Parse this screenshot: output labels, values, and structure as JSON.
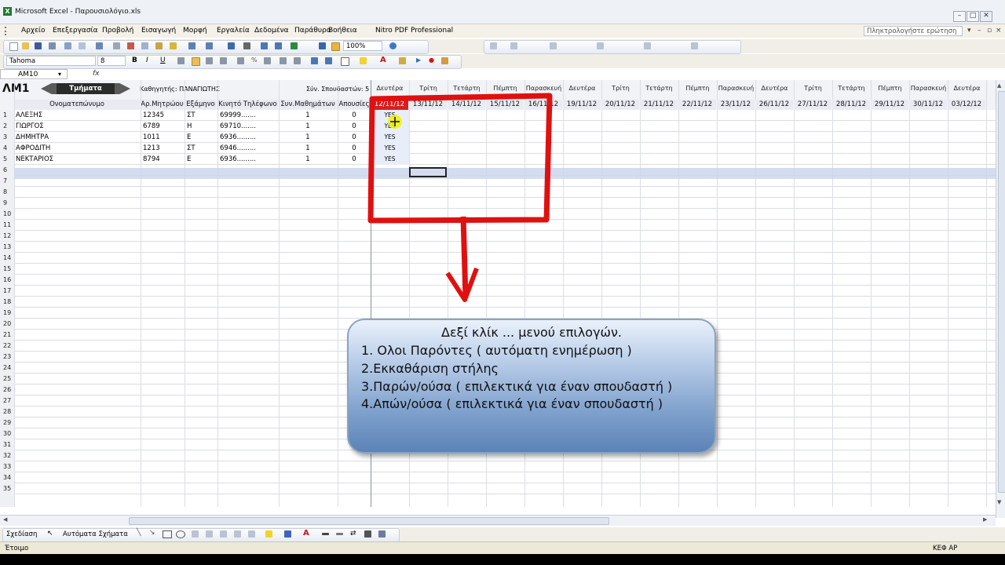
{
  "window": {
    "title": "Microsoft Excel - Παρουσιολόγιο.xls"
  },
  "menu": [
    "Αρχείο",
    "Επεξεργασία",
    "Προβολή",
    "Εισαγωγή",
    "Μορφή",
    "Εργαλεία",
    "Δεδομένα",
    "Παράθυρο",
    "Βοήθεια",
    "Nitro PDF Professional"
  ],
  "ask_box": "Πληκτρολογήστε ερώτηση",
  "toolbar": {
    "zoom": "100%",
    "font": "Tahoma",
    "font_size": "8"
  },
  "name_box": "AM10",
  "fx": "fx",
  "sheet": {
    "title": "ΛΜ1",
    "sections_button": "Τμήματα",
    "teacher_label": "Καθηγητής: ΠΑΝΑΓΙΩΤΗΣ",
    "students_count": "Σύν. Σπουδαστών: 5",
    "columns": [
      "Ονοματεπώνυμο",
      "Αρ.Μητρώου",
      "Εξάμηνο",
      "Κινητό Τηλέφωνο",
      "Συν.Μαθημάτων",
      "Απουσίες"
    ],
    "days": [
      "Δευτέρα",
      "Τρίτη",
      "Τετάρτη",
      "Πέμπτη",
      "Παρασκευή",
      "Δευτέρα",
      "Τρίτη",
      "Τετάρτη",
      "Πέμπτη",
      "Παρασκευή",
      "Δευτέρα",
      "Τρίτη",
      "Τετάρτη",
      "Πέμπτη",
      "Παρασκευή",
      "Δευτέρα"
    ],
    "dates": [
      "12/11/12",
      "13/11/12",
      "14/11/12",
      "15/11/12",
      "16/11/12",
      "19/11/12",
      "20/11/12",
      "21/11/12",
      "22/11/12",
      "23/11/12",
      "26/11/12",
      "27/11/12",
      "28/11/12",
      "29/11/12",
      "30/11/12",
      "03/12/12"
    ],
    "rows": [
      {
        "name": "ΑΛΕΞΗΣ",
        "id": "12345",
        "sem": "ΣΤ",
        "phone": "69999.......",
        "courses": "1",
        "absences": "0",
        "first_day": "YES"
      },
      {
        "name": "ΓΙΩΡΓΟΣ",
        "id": "6789",
        "sem": "Η",
        "phone": "69710.......",
        "courses": "1",
        "absences": "0",
        "first_day": "YES"
      },
      {
        "name": "ΔΗΜΗΤΡΑ",
        "id": "1011",
        "sem": "Ε",
        "phone": "6936.........",
        "courses": "1",
        "absences": "0",
        "first_day": "YES"
      },
      {
        "name": "ΑΦΡΟΔΙΤΗ",
        "id": "1213",
        "sem": "ΣΤ",
        "phone": "6946.........",
        "courses": "1",
        "absences": "0",
        "first_day": "YES"
      },
      {
        "name": "ΝΕΚΤΑΡΙΟΣ",
        "id": "8794",
        "sem": "Ε",
        "phone": "6936.........",
        "courses": "1",
        "absences": "0",
        "first_day": "YES"
      }
    ],
    "row_numbers": [
      "1",
      "2",
      "3",
      "4",
      "5",
      "6",
      "7",
      "8",
      "9",
      "10",
      "11",
      "12",
      "13",
      "14",
      "15",
      "16",
      "17",
      "18",
      "19",
      "20",
      "21",
      "22",
      "23",
      "24",
      "25",
      "26",
      "27",
      "28",
      "29",
      "30",
      "31",
      "32",
      "33",
      "34",
      "35"
    ]
  },
  "callout": {
    "title": "Δεξί κλίκ ... μενού επιλογών.",
    "lines": [
      "1. Ολοι Παρόντες ( αυτόματη ενημέρωση )",
      "2.Εκκαθάριση στήλης",
      "3.Παρών/ούσα ( επιλεκτικά για έναν σπουδαστή )",
      "4.Απών/ούσα ( επιλεκτικά για έναν σπουδαστή )"
    ]
  },
  "drawing": {
    "draw_label": "Σχεδίαση",
    "autoshapes_label": "Αυτόματα Σχήματα"
  },
  "status": {
    "left": "Έτοιμο",
    "right": "ΚΕΦ ΑΡ"
  },
  "colors": {
    "annotation_red": "#e01010",
    "callout_blue": "#7ea0cc",
    "selected_row": "#c9d4ec"
  }
}
